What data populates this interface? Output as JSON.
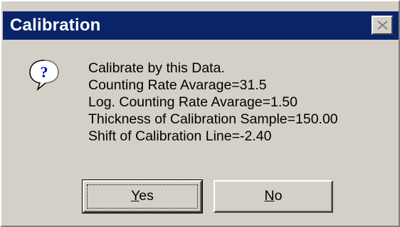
{
  "window": {
    "title": "Calibration",
    "title_bar_color": "#0a246a",
    "face_color": "#d4d0c8"
  },
  "titlebar": {
    "close_icon": "close-icon"
  },
  "message": {
    "icon": "question-icon",
    "lines": [
      "Calibrate by this Data.",
      "Counting Rate Avarage=31.5",
      "Log. Counting Rate Avarage=1.50",
      "Thickness of Calibration Sample=150.00",
      "Shift of Calibration Line=-2.40"
    ]
  },
  "buttons": {
    "yes": {
      "accel": "Y",
      "rest": "es"
    },
    "no": {
      "accel": "N",
      "rest": "o"
    }
  }
}
